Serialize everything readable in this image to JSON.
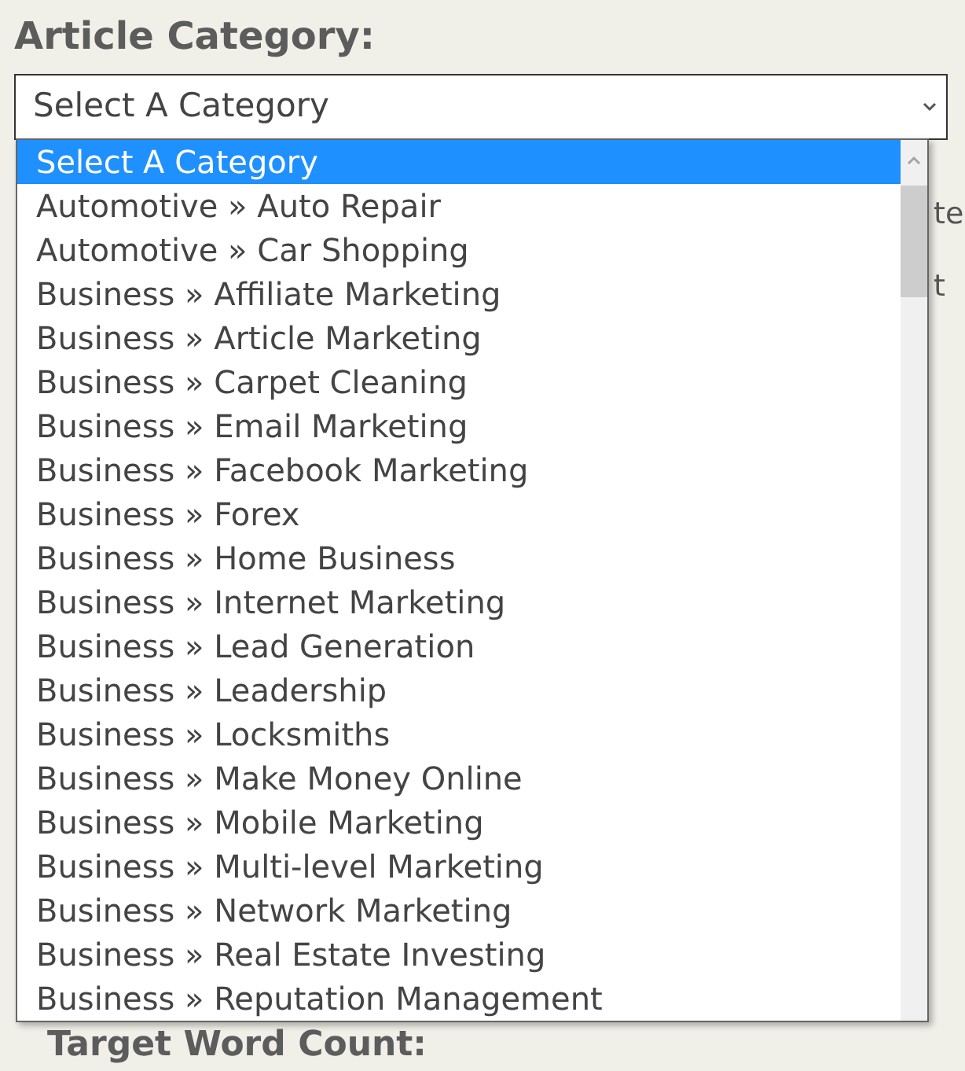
{
  "field_label": "Article Category:",
  "select": {
    "value": "Select A Category"
  },
  "background_fragments": [
    "te",
    "t"
  ],
  "next_field_label": "Target Word Count:",
  "dropdown": {
    "options": [
      {
        "label": "Select A Category",
        "selected": true
      },
      {
        "label": "Automotive » Auto Repair",
        "selected": false
      },
      {
        "label": "Automotive » Car Shopping",
        "selected": false
      },
      {
        "label": "Business » Affiliate Marketing",
        "selected": false
      },
      {
        "label": "Business » Article Marketing",
        "selected": false
      },
      {
        "label": "Business » Carpet Cleaning",
        "selected": false
      },
      {
        "label": "Business » Email Marketing",
        "selected": false
      },
      {
        "label": "Business » Facebook Marketing",
        "selected": false
      },
      {
        "label": "Business » Forex",
        "selected": false
      },
      {
        "label": "Business » Home Business",
        "selected": false
      },
      {
        "label": "Business » Internet Marketing",
        "selected": false
      },
      {
        "label": "Business » Lead Generation",
        "selected": false
      },
      {
        "label": "Business » Leadership",
        "selected": false
      },
      {
        "label": "Business » Locksmiths",
        "selected": false
      },
      {
        "label": "Business » Make Money Online",
        "selected": false
      },
      {
        "label": "Business » Mobile Marketing",
        "selected": false
      },
      {
        "label": "Business » Multi-level Marketing",
        "selected": false
      },
      {
        "label": "Business » Network Marketing",
        "selected": false
      },
      {
        "label": "Business » Real Estate Investing",
        "selected": false
      },
      {
        "label": "Business » Reputation Management",
        "selected": false
      }
    ]
  }
}
